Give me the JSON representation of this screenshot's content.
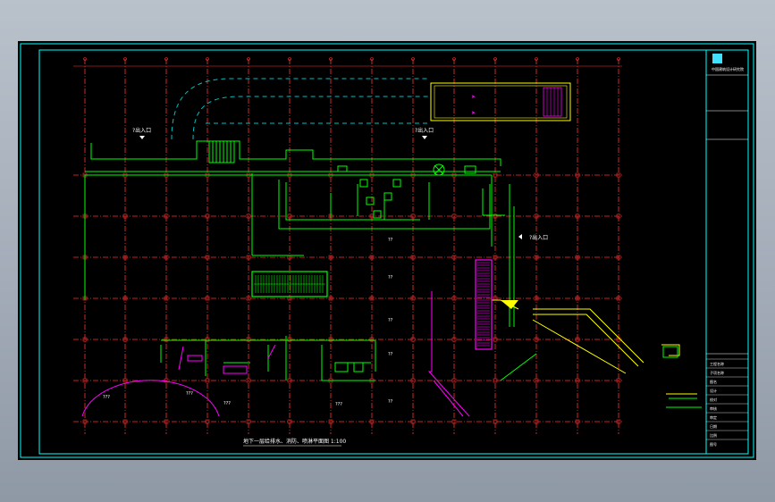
{
  "drawing": {
    "title_text": "地下一层给排水、消防、喷淋平面图 1:100",
    "entrance_1": "?出入口",
    "entrance_2": "?出入口",
    "entrance_3": "?出入口",
    "room_label": "???",
    "mark_small": "??",
    "title_block": {
      "company": "中国建筑设计研究院",
      "rows": [
        "工程名称",
        "子项名称",
        "图名",
        "设计",
        "校对",
        "审核",
        "审定",
        "日期",
        "比例",
        "图号"
      ]
    }
  },
  "colors": {
    "background": "#000000",
    "frame": "#00ffff",
    "grid_axis": "#ff3030",
    "pipes": "#00ff00",
    "walls": "#ffff00",
    "equipment": "#ff00ff",
    "text": "#ffffff",
    "dashed": "#00bfbf"
  }
}
